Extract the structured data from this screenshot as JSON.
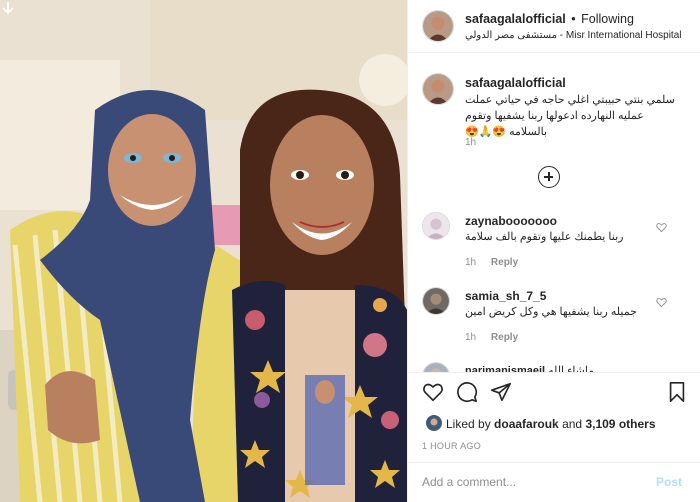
{
  "post": {
    "image_alt": "Two women smiling, one in a navy hijab and striped yellow dress, the other with shoulder-length hair in a floral jacket"
  },
  "header": {
    "username": "safaagalalofficial",
    "separator": "•",
    "follow_status": "Following",
    "location": "مستشفى مصر الدولي - Misr International Hospital"
  },
  "caption": {
    "username": "safaagalalofficial",
    "text": "سلمي بنتي حبيبتي اغلي حاجه في حياتي عملت عمليه النهارده ادعولها ربنا يشفيها وتقوم بالسلامه 😍🙏😍",
    "time": "1h"
  },
  "comments": [
    {
      "username": "zaynabooooooo",
      "text": "ربنا يطمنك عليها وتقوم بالف سلامة",
      "time": "1h",
      "reply_label": "Reply"
    },
    {
      "username": "samia_sh_7_5",
      "text": "جميله ربنا يشفيها هي وكل كريض امين",
      "time": "1h",
      "reply_label": "Reply"
    },
    {
      "username": "narimanismaeil",
      "text": "ماشاء الله",
      "time": "",
      "reply_label": ""
    }
  ],
  "likes": {
    "prefix": "Liked by",
    "user": "doaafarouk",
    "and": "and",
    "others": "3,109 others"
  },
  "post_time": "1 HOUR AGO",
  "comment_box": {
    "placeholder": "Add a comment...",
    "post_label": "Post"
  },
  "icons": {
    "like": "heart-icon",
    "comment": "comment-bubble-icon",
    "share": "paper-plane-icon",
    "save": "bookmark-icon",
    "load_more": "plus-circle-icon"
  },
  "colors": {
    "text": "#262626",
    "muted": "#8e8e8e",
    "border": "#efefef",
    "post_disabled": "#b2dffc"
  }
}
